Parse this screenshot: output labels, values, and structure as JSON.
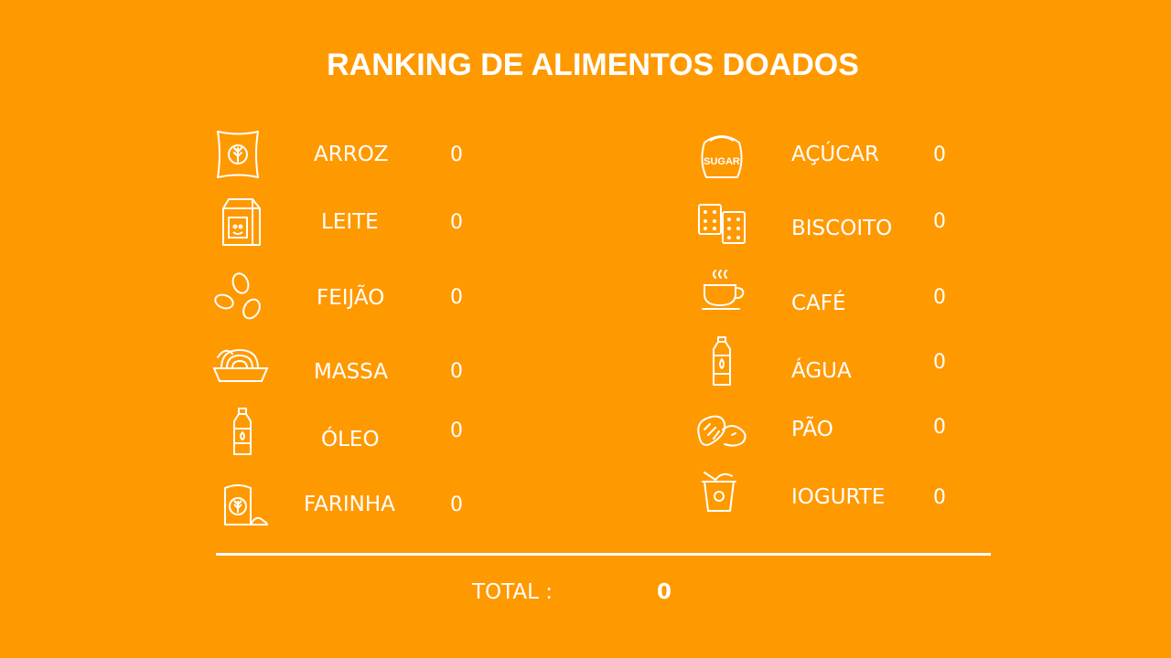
{
  "title": "RANKING DE ALIMENTOS DOADOS",
  "colors": {
    "background": "#FF9900",
    "foreground": "#FFFFFF"
  },
  "left_items": [
    {
      "icon": "rice-bag-icon",
      "label": "ARROZ",
      "value": "0"
    },
    {
      "icon": "milk-carton-icon",
      "label": "LEITE",
      "value": "0"
    },
    {
      "icon": "beans-icon",
      "label": "FEIJÃO",
      "value": "0"
    },
    {
      "icon": "pasta-bowl-icon",
      "label": "MASSA",
      "value": "0"
    },
    {
      "icon": "oil-bottle-icon",
      "label": "ÓLEO",
      "value": "0"
    },
    {
      "icon": "flour-bag-icon",
      "label": "FARINHA",
      "value": "0"
    }
  ],
  "right_items": [
    {
      "icon": "sugar-bag-icon",
      "label": "AÇÚCAR",
      "value": "0"
    },
    {
      "icon": "biscuit-icon",
      "label": "BISCOITO",
      "value": "0"
    },
    {
      "icon": "coffee-cup-icon",
      "label": "CAFÉ",
      "value": "0"
    },
    {
      "icon": "water-bottle-icon",
      "label": "ÁGUA",
      "value": "0"
    },
    {
      "icon": "bread-icon",
      "label": "PÃO",
      "value": "0"
    },
    {
      "icon": "yogurt-icon",
      "label": "IOGURTE",
      "value": "0"
    }
  ],
  "total": {
    "label": "TOTAL :",
    "value": "0"
  },
  "sugar_icon_text": "SUGAR"
}
